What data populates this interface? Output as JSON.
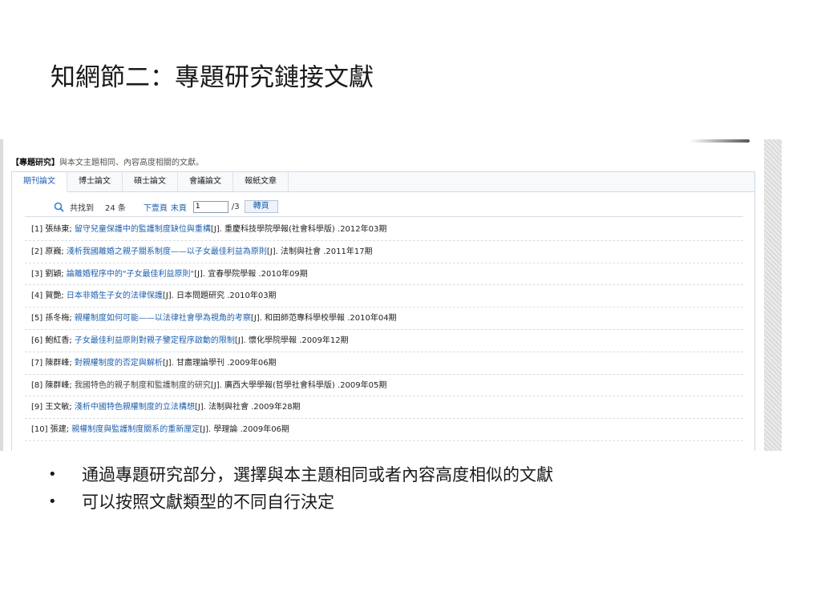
{
  "slide": {
    "title": "知網節二：專題研究鏈接文獻",
    "bullets": [
      "通過專題研究部分，選擇與本主題相同或者內容高度相似的文獻",
      "可以按照文獻類型的不同自行決定"
    ]
  },
  "screenshot": {
    "section_tag": "【專題研究】",
    "section_desc": "與本文主題相同、內容高度相關的文獻。",
    "tabs": [
      {
        "label": "期刊論文",
        "active": true
      },
      {
        "label": "博士論文",
        "active": false
      },
      {
        "label": "碩士論文",
        "active": false
      },
      {
        "label": "會議論文",
        "active": false
      },
      {
        "label": "報紙文章",
        "active": false
      }
    ],
    "pager": {
      "found_label": "共找到",
      "count_label": "24 条",
      "next_label": "下壹頁",
      "last_label": "末頁",
      "page_value": "1",
      "total_label": "/3",
      "go_label": "轉頁"
    },
    "results": [
      {
        "idx": "[1]",
        "author": "張絲東;",
        "title": "留守兒童保護中的監護制度缺位與重構",
        "source": "[J]. 重慶科技學院學報(社會科學版) .2012年03期",
        "linked": true
      },
      {
        "idx": "[2]",
        "author": "原巍;",
        "title": "淺析我國離婚之親子關系制度——以子女最佳利益為原則",
        "source": "[J]. 法制與社會 .2011年17期",
        "linked": true
      },
      {
        "idx": "[3]",
        "author": "劉穎;",
        "title": "論離婚程序中的\"子女最佳利益原則\"",
        "source": "[J]. 宜春學院學報 .2010年09期",
        "linked": true
      },
      {
        "idx": "[4]",
        "author": "賀艷;",
        "title": "日本非婚生子女的法律保護",
        "source": "[J]. 日本問題研究 .2010年03期",
        "linked": true
      },
      {
        "idx": "[5]",
        "author": "孫冬梅;",
        "title": "親權制度如何可能——以法律社會學為視角的考察",
        "source": "[J]. 和田師范專科學校學報 .2010年04期",
        "linked": true
      },
      {
        "idx": "[6]",
        "author": "鮑紅香;",
        "title": "子女最佳利益原則對親子鑒定程序啟動的限制",
        "source": "[J]. 懷化學院學報 .2009年12期",
        "linked": true
      },
      {
        "idx": "[7]",
        "author": "陳群峰;",
        "title": "對親權制度的否定與解析",
        "source": "[J]. 甘肅理論學刊 .2009年06期",
        "linked": true
      },
      {
        "idx": "[8]",
        "author": "陳群峰;",
        "title": "我國特色的親子制度和監護制度的研究",
        "source": "[J]. 廣西大學學報(哲學社會科學版) .2009年05期",
        "linked": false
      },
      {
        "idx": "[9]",
        "author": "王文敏;",
        "title": "淺析中國特色親權制度的立法構想",
        "source": "[J]. 法制與社會 .2009年28期",
        "linked": true
      },
      {
        "idx": "[10]",
        "author": "張建;",
        "title": "親權制度與監護制度關系的重新厘定",
        "source": "[J]. 學理論 .2009年06期",
        "linked": true
      }
    ]
  },
  "colors": {
    "link": "#1d5fae",
    "border": "#cfd8e3"
  }
}
